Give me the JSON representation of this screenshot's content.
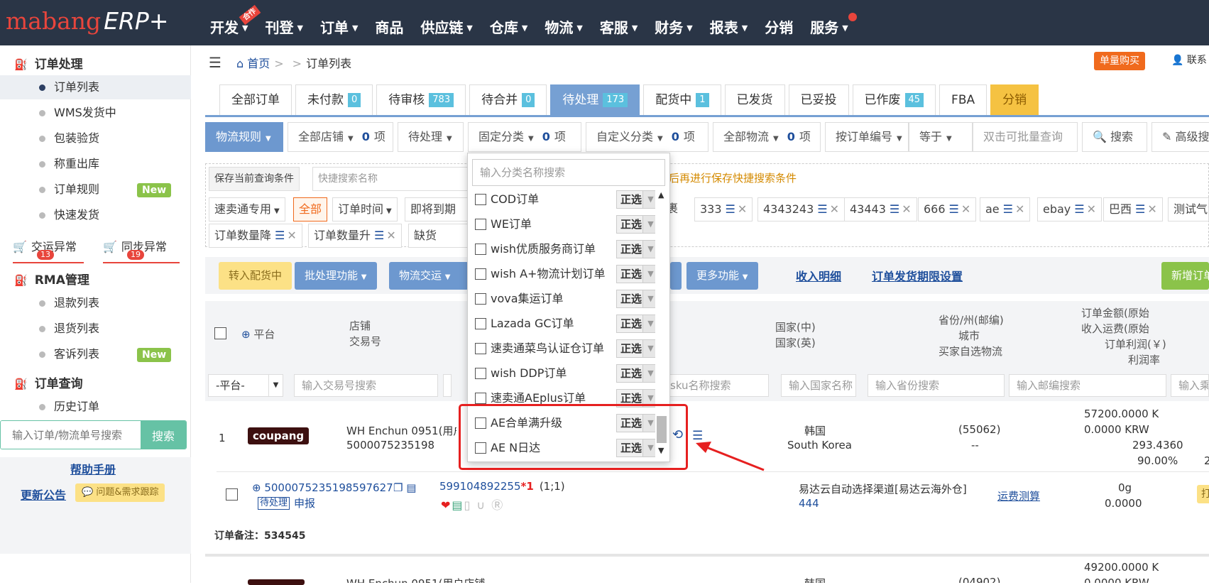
{
  "brand": {
    "text": "mabang",
    "erp": "ERP+"
  },
  "nav": {
    "items": [
      "开发",
      "刊登",
      "订单",
      "商品",
      "供应链",
      "仓库",
      "物流",
      "客服",
      "财务",
      "报表",
      "分销",
      "服务"
    ],
    "badge": "合作"
  },
  "sidebar": {
    "order_processing": "订单处理",
    "items": [
      "订单列表",
      "WMS发货中",
      "包装验货",
      "称重出库",
      "订单规则",
      "快速发货"
    ],
    "new_label": "New",
    "exc1": {
      "label": "交运异常",
      "count": "13"
    },
    "exc2": {
      "label": "同步异常",
      "count": "19"
    },
    "rma": "RMA管理",
    "rma_items": [
      "退款列表",
      "退货列表",
      "客诉列表"
    ],
    "order_query": "订单查询",
    "history": "历史订单",
    "search_placeholder": "输入订单/物流单号搜索",
    "search_btn": "搜索",
    "help": "帮助手册",
    "update": "更新公告",
    "issue": "问题&需求跟踪"
  },
  "breadcrumb": {
    "home": "首页",
    "sep": ">",
    "current": "订单列表"
  },
  "topright": {
    "buy": "单量购买",
    "contact": "联系"
  },
  "tabs": [
    {
      "label": "全部订单",
      "count": ""
    },
    {
      "label": "未付款",
      "count": "0"
    },
    {
      "label": "待审核",
      "count": "783"
    },
    {
      "label": "待合并",
      "count": "0"
    },
    {
      "label": "待处理",
      "count": "173"
    },
    {
      "label": "配货中",
      "count": "1"
    },
    {
      "label": "已发货",
      "count": ""
    },
    {
      "label": "已妥投",
      "count": ""
    },
    {
      "label": "已作废",
      "count": "45"
    },
    {
      "label": "FBA",
      "count": ""
    },
    {
      "label": "分销",
      "count": ""
    }
  ],
  "filters": {
    "rule": "物流规则",
    "shops": "全部店铺",
    "shops_n": "0",
    "shops_unit": "项",
    "status": "待处理",
    "fixed": "固定分类",
    "fixed_n": "0",
    "fixed_unit": "项",
    "custom": "自定义分类",
    "custom_n": "0",
    "custom_unit": "项",
    "logistics": "全部物流",
    "logistics_n": "0",
    "logistics_unit": "项",
    "by": "按订单编号",
    "eq": "等于",
    "query_ph": "双击可批量查询",
    "search": "搜索",
    "advanced": "高级搜"
  },
  "save": {
    "label": "保存当前查询条件",
    "placeholder": "快捷搜索名称",
    "hint": "后再进行保存快捷搜索条件"
  },
  "chips1": [
    "速卖通专用",
    "全部",
    "订单时间",
    "即将到期",
    "裹",
    "333",
    "4343243",
    "43443",
    "666",
    "ae",
    "ebay",
    "巴西",
    "测试气泡"
  ],
  "chips2": [
    "订单数量降",
    "订单数量升",
    "缺货"
  ],
  "actions": {
    "to_dist": "转入配货中",
    "batch": "批处理功能",
    "ship": "物流交运",
    "more": "更多功能",
    "income": "收入明细",
    "deadline": "订单发货期限设置",
    "new": "新增订单"
  },
  "thead": {
    "platform": "平台",
    "shop": "店铺",
    "txn": "交易号",
    "country_cn": "国家(中)",
    "country_en": "国家(英)",
    "province": "省份/州(邮编)",
    "city": "城市",
    "buyer": "买家自选物流",
    "amount": "订单金额(原始",
    "freight": "收入运费(原始",
    "profit": "订单利润(￥)",
    "rate": "利润率"
  },
  "filter_inputs": {
    "platform": "-平台-",
    "txn": "输入交易号搜索",
    "sku": "sku名称搜索",
    "country": "输入国家名称",
    "province": "输入省份搜索",
    "zip": "输入邮编搜索",
    "freight": "输入乘"
  },
  "row": {
    "no": "1",
    "platform": "coupang",
    "shop": "WH Enchun 0951(用户店铺",
    "txn": "5000075235198",
    "country_cn": "韩国",
    "country_en": "South Korea",
    "zip": "(55062)",
    "city": "--",
    "amount": "57200.0000 K",
    "freight": "0.0000 KRW",
    "profit": "293.4360",
    "rate": "90.00%",
    "extra": "2",
    "order_id": "5000075235198597627",
    "status": "待处理",
    "declare": "申报",
    "sku": "599104892255",
    "qty_mark": "*1",
    "qty": "(1;1)",
    "channel": "易达云自动选择渠道[易达云海外仓]",
    "channel_code": "444",
    "calc": "运费测算",
    "weight": "0g",
    "weight_amt": "0.0000",
    "print": "打印",
    "note": "订单备注：534545",
    "next_shop": "WH Enchun 0951(用户店铺",
    "next_country": "韩国",
    "next_zip": "(04902)",
    "next_amount": "49200.0000 K",
    "next_freight": "0.0000 KRW"
  },
  "dropdown": {
    "placeholder": "输入分类名称搜索",
    "items": [
      "COD订单",
      "WE订单",
      "wish优质服务商订单",
      "wish A+物流计划订单",
      "vova集运订单",
      "Lazada GC订单",
      "速卖通菜鸟认证仓订单",
      "wish DDP订单",
      "速卖通AEplus订单",
      "AE合单满升级",
      "AE N日达"
    ],
    "select_label": "正选"
  }
}
